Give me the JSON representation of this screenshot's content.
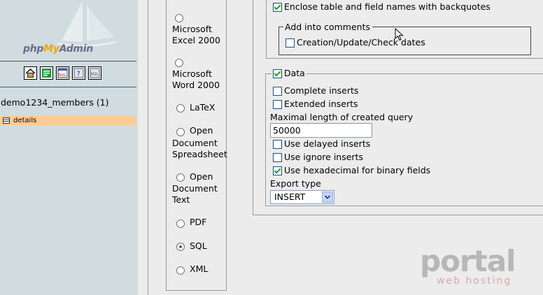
{
  "sidebar": {
    "logo": {
      "php": "php",
      "my": "My",
      "admin": "Admin"
    },
    "icons": [
      "home-icon",
      "query-window-icon",
      "sql-icon",
      "help-icon",
      "sql-docs-icon"
    ],
    "database_name": "demo1234_members (1)",
    "tables": [
      {
        "label": "details"
      }
    ]
  },
  "export": {
    "formats": [
      {
        "label": "Microsoft Excel 2000",
        "selected": false
      },
      {
        "label": "Microsoft Word 2000",
        "selected": false
      },
      {
        "label": "LaTeX",
        "selected": false
      },
      {
        "label": "Open Document Spreadsheet",
        "selected": false
      },
      {
        "label": "Open Document Text",
        "selected": false
      },
      {
        "label": "PDF",
        "selected": false
      },
      {
        "label": "SQL",
        "selected": true
      },
      {
        "label": "XML",
        "selected": false
      }
    ],
    "structure": {
      "backquotes_label": "Enclose table and field names with backquotes",
      "backquotes_checked": true,
      "comments_legend": "Add into comments",
      "dates_label": "Creation/Update/Check dates",
      "dates_checked": false
    },
    "data": {
      "legend": "Data",
      "legend_checked": true,
      "complete_inserts": "Complete inserts",
      "extended_inserts": "Extended inserts",
      "max_length_label": "Maximal length of created query",
      "max_length_value": "50000",
      "delayed_inserts": "Use delayed inserts",
      "ignore_inserts": "Use ignore inserts",
      "hex_binary": "Use hexadecimal for binary fields",
      "hex_binary_checked": true,
      "export_type_label": "Export type",
      "export_type_value": "INSERT"
    }
  },
  "watermark": {
    "brand": "portal",
    "tagline": "web hosting"
  }
}
